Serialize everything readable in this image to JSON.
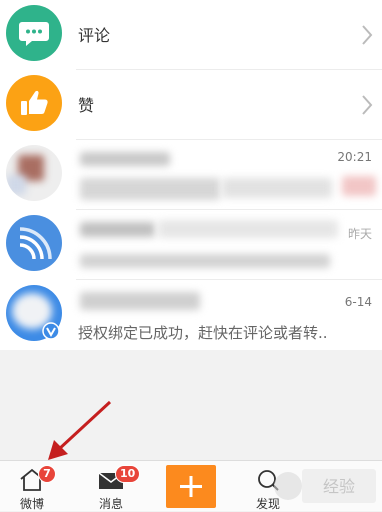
{
  "rows": [
    {
      "label": "评论"
    },
    {
      "label": "赞"
    }
  ],
  "messages": [
    {
      "time": "20:21",
      "preview": ""
    },
    {
      "time": "昨天",
      "preview": ""
    },
    {
      "time": "6-14",
      "preview": "授权绑定已成功，赶快在评论或者转.."
    }
  ],
  "tabbar": {
    "tabs": [
      {
        "label": "微博",
        "badge": "7",
        "icon": "home-icon"
      },
      {
        "label": "消息",
        "badge": "10",
        "icon": "envelope-icon"
      },
      {
        "label": "",
        "icon": "plus-icon"
      },
      {
        "label": "发现",
        "icon": "search-icon"
      }
    ]
  },
  "colors": {
    "comment_avatar": "#2fb38b",
    "like_avatar": "#fca214",
    "blue_avatar": "#4a8fe0",
    "plus_button": "#fc8a1e",
    "badge": "#e8453a",
    "arrow": "#c51f1f"
  },
  "watermark": "Baidu 经验"
}
